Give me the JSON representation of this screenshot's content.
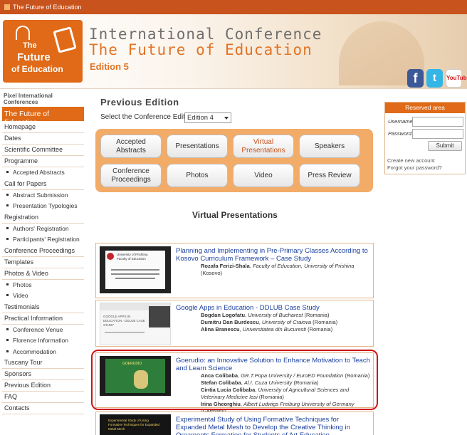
{
  "topbar": {
    "label": "The Future of Education"
  },
  "banner": {
    "logo": {
      "line1": "The",
      "line2": "Future",
      "line3": "of Education"
    },
    "title1": "International Conference",
    "title2": "The Future of Education",
    "edition": "Edition 5"
  },
  "social": {
    "facebook": "f",
    "twitter": "t",
    "youtube": "YouTube"
  },
  "sidebar": {
    "header": "Pixel International Conferences",
    "active": "The Future of Education",
    "items": [
      {
        "label": "Homepage",
        "sub": false
      },
      {
        "label": "Dates",
        "sub": false
      },
      {
        "label": "Scientific Committee",
        "sub": false
      },
      {
        "label": "Programme",
        "sub": false
      },
      {
        "label": "Accepted Abstracts",
        "sub": true
      },
      {
        "label": "Call for Papers",
        "sub": false
      },
      {
        "label": "Abstract Submission",
        "sub": true
      },
      {
        "label": "Presentation Typologies",
        "sub": true
      },
      {
        "label": "Registration",
        "sub": false
      },
      {
        "label": "Authors' Registration",
        "sub": true
      },
      {
        "label": "Participants' Registration",
        "sub": true
      },
      {
        "label": "Conference Proceedings",
        "sub": false
      },
      {
        "label": "Templates",
        "sub": false
      },
      {
        "label": "Photos & Video",
        "sub": false
      },
      {
        "label": "Photos",
        "sub": true
      },
      {
        "label": "Video",
        "sub": true
      },
      {
        "label": "Testimonials",
        "sub": false
      },
      {
        "label": "Practical Information",
        "sub": false
      },
      {
        "label": "Conference Venue",
        "sub": true
      },
      {
        "label": "Florence Information",
        "sub": true
      },
      {
        "label": "Accommodation",
        "sub": true
      },
      {
        "label": "Tuscany Tour",
        "sub": false
      },
      {
        "label": "Sponsors",
        "sub": false
      },
      {
        "label": "Previous Edition",
        "sub": false
      },
      {
        "label": "FAQ",
        "sub": false
      },
      {
        "label": "Contacts",
        "sub": false
      }
    ]
  },
  "main": {
    "title": "Previous Edition",
    "select_label": "Select the Conference Edition",
    "select_value": "Edition 4",
    "buttons": [
      {
        "label": "Accepted Abstracts",
        "active": false
      },
      {
        "label": "Presentations",
        "active": false
      },
      {
        "label": "Virtual Presentations",
        "active": true
      },
      {
        "label": "Speakers",
        "active": false
      },
      {
        "label": "Conference Proceedings",
        "active": false
      },
      {
        "label": "Photos",
        "active": false
      },
      {
        "label": "Video",
        "active": false
      },
      {
        "label": "Press Review",
        "active": false
      }
    ],
    "section_title": "Virtual Presentations",
    "entries": [
      {
        "title": "Planning and Implementing in Pre-Primary Classes According to Kosovo Curriculum Framework – Case Study",
        "thumb": {
          "line1": "University of Prishtina",
          "line2": "Faculty of Education"
        },
        "authors": [
          {
            "name": "Rozafa Ferizi-Shala",
            "affiliation": "Faculty of Education, University of Prishina",
            "country": "(Kosovo)"
          }
        ]
      },
      {
        "title": "Google Apps in Education - DDLUB Case Study",
        "thumb": {
          "line1": "GOOGLE APPS IN EDUCATION - DDLUB CASE STUDY",
          "line2": ""
        },
        "authors": [
          {
            "name": "Bogdan Logofatu",
            "affiliation": "University of Bucharest",
            "country": "(Romania)"
          },
          {
            "name": "Dumitru Dan Burdescu",
            "affiliation": "University of Craiova",
            "country": "(Romania)"
          },
          {
            "name": "Alina Branescu",
            "affiliation": "Universitatea din Bucuresti",
            "country": "(Romania)"
          }
        ]
      },
      {
        "title": "Goerudio: an Innovative Solution to Enhance Motivation to Teach and Learn Science",
        "thumb": {
          "line1": "GOERUDIO",
          "line2": ""
        },
        "authors": [
          {
            "name": "Anca Colibaba",
            "affiliation": "GR.T.Popa University / EuroED Foundation",
            "country": "(Romania)"
          },
          {
            "name": "Stefan Colibaba",
            "affiliation": "Al.I. Cuza University",
            "country": "(Romania)"
          },
          {
            "name": "Cintia Lucia Colibaba",
            "affiliation": "University of Agricultural Sciences and Veterinary Medicine Iasi",
            "country": "(Romania)"
          },
          {
            "name": "Irina Gheorghiu",
            "affiliation": "Albert Ludwigs Freiburg University of Germany",
            "country": "(Germany)"
          }
        ]
      },
      {
        "title": "Experimental Study of Using Formative Techniques for Expanded Metal Mesh to Develop the Creative Thinking in Ornaments Formation for Students of Art Education",
        "thumb": {
          "line1": "Experimental Study of Using Formative Techniques for Expanded Metal Mesh",
          "line2": ""
        },
        "authors": []
      }
    ]
  },
  "reserved": {
    "title": "Reserved area",
    "username_label": "Username:",
    "password_label": "Password:",
    "submit": "Submit",
    "create": "Create new account",
    "forgot": "Forgot your password?"
  },
  "colors": {
    "accent": "#e06a17",
    "topbar": "#c8531c",
    "link": "#1a3f9e",
    "highlight": "#d01212"
  }
}
